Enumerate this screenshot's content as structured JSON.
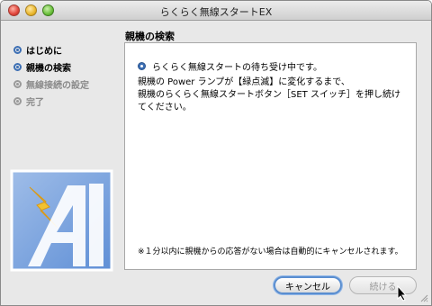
{
  "window": {
    "title": "らくらく無線スタートEX"
  },
  "steps": [
    {
      "label": "はじめに",
      "state": "done"
    },
    {
      "label": "親機の検索",
      "state": "current"
    },
    {
      "label": "無線接続の設定",
      "state": "pending"
    },
    {
      "label": "完了",
      "state": "pending"
    }
  ],
  "section": {
    "title": "親機の検索"
  },
  "panel": {
    "heading": "らくらく無線スタートの待ち受け中です。",
    "body_line1": "親機の Power ランプが【緑点滅】に変化するまで、",
    "body_line2": "親機のらくらく無線スタートボタン［SET スイッチ］を押し続け",
    "body_line3": "てください。",
    "note": "※１分以内に親機からの応答がない場合は自動的にキャンセルされます。"
  },
  "buttons": {
    "cancel_label": "キャンセル",
    "continue_label": "続ける"
  },
  "colors": {
    "accent": "#3c6fb4",
    "logo_blue": "#3a6fc7",
    "logo_yellow": "#f2c230"
  },
  "icons": {
    "close": "close-icon",
    "minimize": "minimize-icon",
    "zoom": "zoom-icon",
    "logo": "aoss-logo",
    "info": "info-bullet-icon",
    "cursor": "mouse-pointer-icon"
  }
}
